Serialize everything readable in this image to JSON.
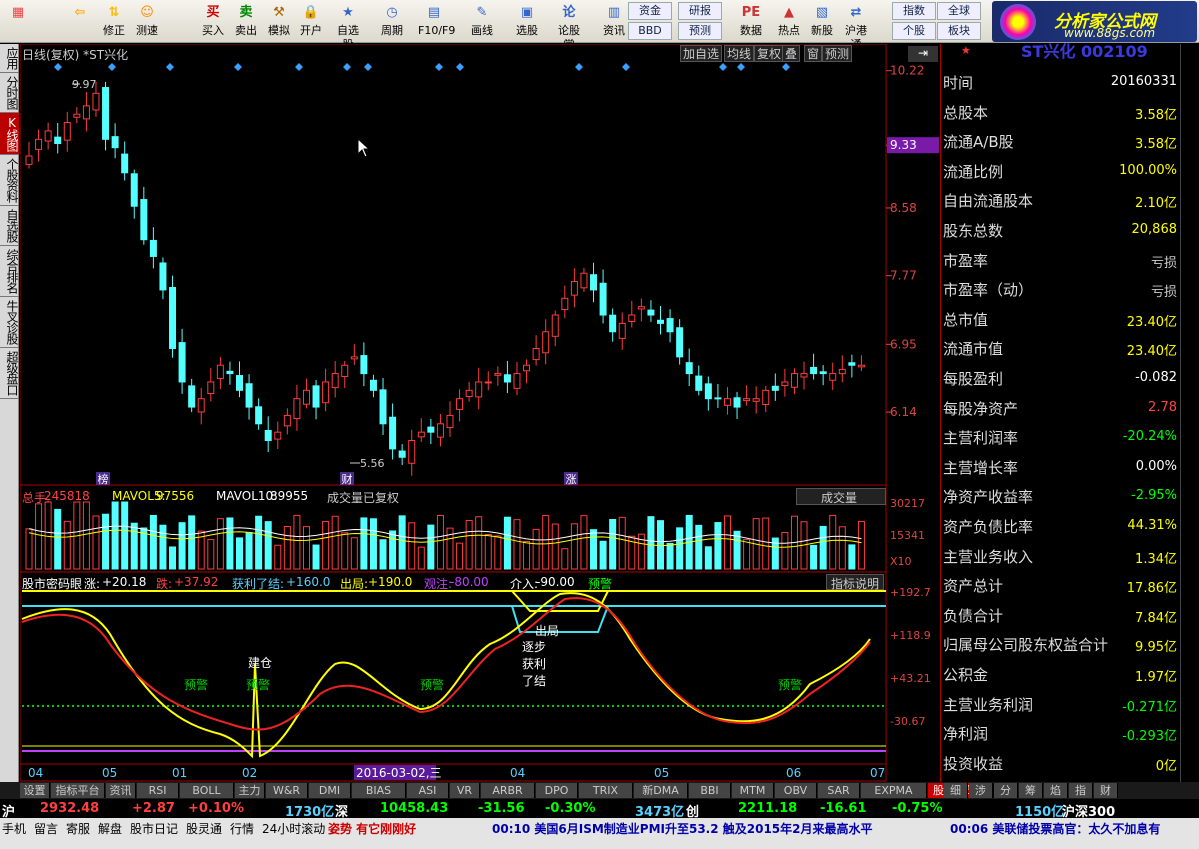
{
  "toolbar": {
    "buttons": [
      {
        "label": "",
        "icon": "window-icon"
      },
      {
        "label": "",
        "icon": "back-arrow-icon"
      },
      {
        "label": "修正",
        "icon": "up-down-icon"
      },
      {
        "label": "测速",
        "icon": "stopwatch-icon"
      },
      {
        "label": "买入",
        "icon": "buy-icon"
      },
      {
        "label": "卖出",
        "icon": "sell-icon"
      },
      {
        "label": "模拟",
        "icon": "hammer-icon"
      },
      {
        "label": "开户",
        "icon": "lock-icon"
      },
      {
        "label": "自选股",
        "icon": "star-icon"
      },
      {
        "label": "周期",
        "icon": "clock-icon"
      },
      {
        "label": "F10/F9",
        "icon": "info-icon"
      },
      {
        "label": "画线",
        "icon": "pen-icon"
      },
      {
        "label": "选股",
        "icon": "monitor-icon"
      },
      {
        "label": "论股堂",
        "icon": "chat-icon"
      },
      {
        "label": "资讯",
        "icon": "news-icon"
      },
      {
        "label": "数据",
        "icon": "pe-icon"
      },
      {
        "label": "热点",
        "icon": "hot-icon"
      },
      {
        "label": "新股",
        "icon": "ipo-icon"
      },
      {
        "label": "沪港通",
        "icon": "sse-hk-icon"
      }
    ],
    "small": [
      "资金",
      "研报",
      "BBD",
      "预测",
      "指数",
      "全球",
      "个股",
      "板块"
    ],
    "logo_title": "分析家公式网",
    "logo_url": "www.88gs.com"
  },
  "sidebar": [
    "应用",
    "分时图",
    "K线图",
    "个股资料",
    "自选股",
    "综合排名",
    "牛叉诊股",
    "超级盘口"
  ],
  "chart": {
    "title": "日线(复权) *ST兴化",
    "top_buttons": [
      "加自选",
      "均线",
      "复权",
      "叠",
      "窗",
      "预测"
    ],
    "price_ticks": [
      "10.22",
      "9.33",
      "8.58",
      "7.77",
      "6.95",
      "6.14"
    ],
    "highlight_price": "9.33",
    "high_mark": "9.97",
    "low_mark": "5.56",
    "badges": [
      "榜",
      "财",
      "涨"
    ],
    "vol_header": {
      "total_label": "总手:",
      "total": "245818",
      "mavol5_label": "MAVOL5:",
      "mavol5": "97556",
      "mavol10_label": "MAVOL10:",
      "mavol10": "89955",
      "note": "成交量已复权",
      "dropdown": "成交量"
    },
    "vol_ticks": [
      "30217",
      "15341",
      "X10"
    ],
    "ind_header": {
      "name": "股市密码眼",
      "zhang_label": "涨:",
      "zhang": "+20.18",
      "die_label": "跌:",
      "die": "+37.92",
      "hl_label": "获利了结:",
      "hl": "+160.0",
      "cj_label": "出局:",
      "cj": "+190.0",
      "gw_label": "观注:",
      "gw": "-80.00",
      "jr_label": "介入:",
      "jr": "-90.00",
      "yj": "预警",
      "explain": "指标说明"
    },
    "ind_ticks": [
      "+192.7",
      "+118.9",
      "+43.21",
      "-30.67"
    ],
    "ind_labels": {
      "jiancang": "建仓",
      "yujing": "预警",
      "chuju": "出局",
      "zhubu": "逐步",
      "huoli": "获利",
      "liaojie": "了结"
    },
    "date_labels": [
      "04",
      "05",
      "01",
      "02",
      "2016-03-02,三",
      "04",
      "05",
      "06",
      "07"
    ]
  },
  "chart_data": {
    "type": "candlestick",
    "title": "日线(复权) *ST兴化",
    "ylim": [
      5.4,
      10.3
    ],
    "yticks": [
      10.22,
      9.33,
      8.58,
      7.77,
      6.95,
      6.14
    ],
    "high": 9.97,
    "low": 5.56,
    "close": [
      9.2,
      9.4,
      9.5,
      9.35,
      9.6,
      9.7,
      9.8,
      9.95,
      9.4,
      9.3,
      9.0,
      8.6,
      8.2,
      8.0,
      7.6,
      6.9,
      6.5,
      6.2,
      6.3,
      6.5,
      6.7,
      6.6,
      6.4,
      6.2,
      6.0,
      5.8,
      5.9,
      6.1,
      6.3,
      6.4,
      6.2,
      6.5,
      6.6,
      6.7,
      6.8,
      6.6,
      6.4,
      6.0,
      5.7,
      5.6,
      5.8,
      5.9,
      5.9,
      6.0,
      6.1,
      6.3,
      6.4,
      6.5,
      6.5,
      6.6,
      6.5,
      6.6,
      6.7,
      6.9,
      7.1,
      7.3,
      7.5,
      7.7,
      7.8,
      7.6,
      7.3,
      7.1,
      7.2,
      7.3,
      7.4,
      7.3,
      7.2,
      7.1,
      6.8,
      6.6,
      6.4,
      6.3,
      6.3,
      6.3,
      6.2,
      6.3,
      6.3,
      6.4,
      6.4,
      6.5,
      6.6,
      6.6,
      6.6,
      6.6,
      6.6,
      6.65,
      6.7,
      6.7
    ],
    "volume_ticks": [
      30217,
      15341
    ]
  },
  "right_panel": {
    "stock_header": "ST兴化 002109",
    "rows": [
      {
        "k": "时间",
        "v": "20160331",
        "c": "#fff"
      },
      {
        "k": "总股本",
        "v": "3.58亿",
        "c": "#ff0"
      },
      {
        "k": "流通A/B股",
        "v": "3.58亿",
        "c": "#ff0"
      },
      {
        "k": "流通比例",
        "v": "100.00%",
        "c": "#ff0"
      },
      {
        "k": "自由流通股本",
        "v": "2.10亿",
        "c": "#ff0"
      },
      {
        "k": "股东总数",
        "v": "20,868",
        "c": "#ff0"
      },
      {
        "k": "市盈率",
        "v": "亏损",
        "c": "#ccc"
      },
      {
        "k": "市盈率（动）",
        "v": "亏损",
        "c": "#ccc"
      },
      {
        "k": "总市值",
        "v": "23.40亿",
        "c": "#ff0"
      },
      {
        "k": "流通市值",
        "v": "23.40亿",
        "c": "#ff0"
      },
      {
        "k": "每股盈利",
        "v": "-0.082",
        "c": "#fff"
      },
      {
        "k": "每股净资产",
        "v": "2.78",
        "c": "#f44"
      },
      {
        "k": "主营利润率",
        "v": "-20.24%",
        "c": "#0f0"
      },
      {
        "k": "主营增长率",
        "v": "0.00%",
        "c": "#fff"
      },
      {
        "k": "净资产收益率",
        "v": "-2.95%",
        "c": "#0f0"
      },
      {
        "k": "资产负债比率",
        "v": "44.31%",
        "c": "#ff0"
      },
      {
        "k": "主营业务收入",
        "v": "1.34亿",
        "c": "#ff0"
      },
      {
        "k": "资产总计",
        "v": "17.86亿",
        "c": "#ff0"
      },
      {
        "k": "负债合计",
        "v": "7.84亿",
        "c": "#ff0"
      },
      {
        "k": "归属母公司股东权益合计",
        "v": "9.95亿",
        "c": "#ff0"
      },
      {
        "k": "公积金",
        "v": "1.97亿",
        "c": "#ff0"
      },
      {
        "k": "主营业务利润",
        "v": "-0.271亿",
        "c": "#0f0"
      },
      {
        "k": "净利润",
        "v": "-0.293亿",
        "c": "#0f0"
      },
      {
        "k": "投资收益",
        "v": "0亿",
        "c": "#ff0"
      }
    ]
  },
  "tabs": [
    "设置",
    "指标平台",
    "资讯",
    "RSI",
    "BOLL",
    "主力",
    "W&R",
    "DMI",
    "BIAS",
    "ASI",
    "VR",
    "ARBR",
    "DPO",
    "TRIX",
    "新DMA",
    "BBI",
    "MTM",
    "OBV",
    "SAR",
    "EXPMA",
    "股市密码眼"
  ],
  "right_tabs": [
    "细",
    "涉",
    "分",
    "筹",
    "焰",
    "指",
    "财"
  ],
  "index_bar": {
    "sh_label": "沪",
    "sh": "2932.48",
    "sh_chg": "+2.87",
    "sh_pct": "+0.10%",
    "sh_amt": "1730亿",
    "sz_label": "深",
    "sz": "10458.43",
    "sz_chg": "-31.56",
    "sz_pct": "-0.30%",
    "sz_amt": "3473亿",
    "cy_label": "创",
    "cy": "2211.18",
    "cy_chg": "-16.61",
    "cy_pct": "-0.75%",
    "hs_amt": "1150亿",
    "hs_label": "沪深300"
  },
  "status": {
    "items": [
      "手机",
      "留言",
      "寄服",
      "解盘",
      "股市日记",
      "股灵通",
      "行情",
      "24小时滚动"
    ],
    "ticker": "姿势 有它刚刚好",
    "news1": "00:10 美国6月ISM制造业PMI升至53.2 触及2015年2月来最高水平",
    "news2": "00:06 美联储投票高官：太久不加息有"
  },
  "colors": {
    "up": "#ff3c3c",
    "down": "#54ffff",
    "yellow": "#ffff00",
    "magenta": "#c040ff",
    "cyan": "#40e0f0"
  }
}
